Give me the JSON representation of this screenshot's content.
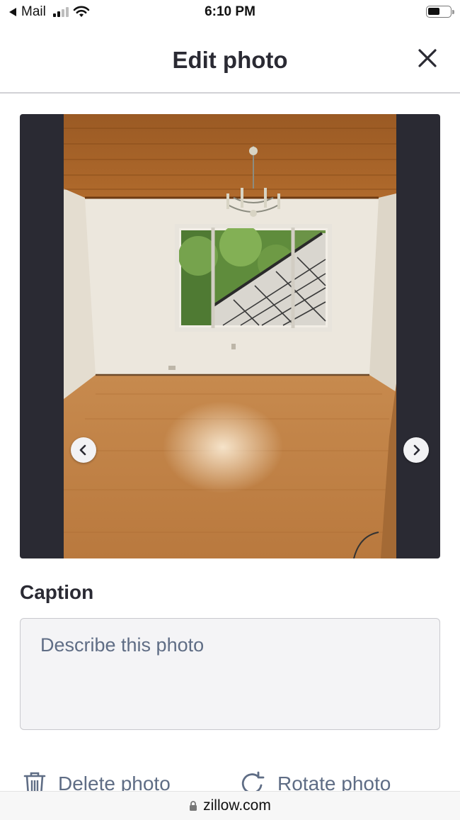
{
  "status_bar": {
    "back_app": "Mail",
    "time": "6:10 PM"
  },
  "header": {
    "title": "Edit photo",
    "close_icon": "close-icon"
  },
  "photo_viewer": {
    "prev_icon": "chevron-left-icon",
    "next_icon": "chevron-right-icon"
  },
  "caption": {
    "label": "Caption",
    "value": "",
    "placeholder": "Describe this photo"
  },
  "actions": {
    "delete_label": "Delete photo",
    "delete_icon": "trash-icon",
    "rotate_label": "Rotate photo",
    "rotate_icon": "rotate-icon"
  },
  "browser": {
    "url": "zillow.com",
    "lock_icon": "lock-icon"
  },
  "colors": {
    "text_primary": "#2a2a33",
    "text_secondary": "#5f6d85",
    "viewer_background": "#2a2a33",
    "input_background": "#f4f4f6"
  }
}
